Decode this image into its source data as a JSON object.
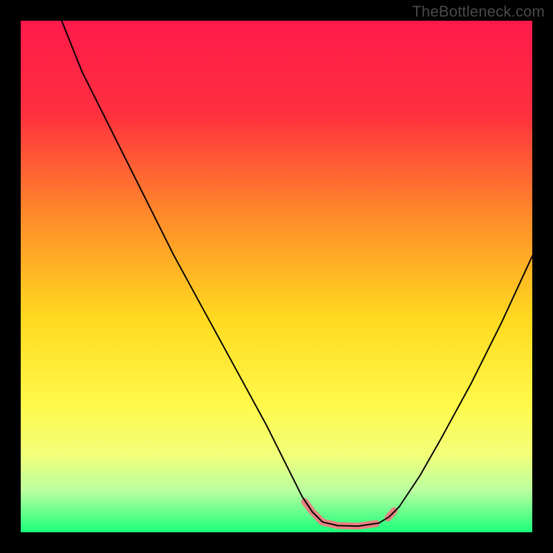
{
  "watermark": "TheBottleneck.com",
  "chart_data": {
    "type": "line",
    "title": "",
    "xlabel": "",
    "ylabel": "",
    "xlim": [
      0,
      100
    ],
    "ylim": [
      0,
      100
    ],
    "background_gradient": {
      "stops": [
        {
          "offset": 0.0,
          "color": "#ff1a4b"
        },
        {
          "offset": 0.18,
          "color": "#ff2f3f"
        },
        {
          "offset": 0.38,
          "color": "#ff8a2a"
        },
        {
          "offset": 0.58,
          "color": "#ffd91f"
        },
        {
          "offset": 0.75,
          "color": "#fff94a"
        },
        {
          "offset": 0.85,
          "color": "#f1ff7a"
        },
        {
          "offset": 0.92,
          "color": "#b8ffa0"
        },
        {
          "offset": 1.0,
          "color": "#1aff7a"
        }
      ]
    },
    "series": [
      {
        "name": "bottleneck-curve",
        "color": "#000000",
        "width": 2,
        "points": [
          {
            "x": 8.0,
            "y": 100.0
          },
          {
            "x": 12.0,
            "y": 90.0
          },
          {
            "x": 18.0,
            "y": 78.0
          },
          {
            "x": 24.0,
            "y": 66.0
          },
          {
            "x": 30.0,
            "y": 54.0
          },
          {
            "x": 36.0,
            "y": 43.0
          },
          {
            "x": 42.0,
            "y": 32.0
          },
          {
            "x": 48.0,
            "y": 21.0
          },
          {
            "x": 52.0,
            "y": 13.0
          },
          {
            "x": 55.0,
            "y": 7.0
          },
          {
            "x": 57.0,
            "y": 4.0
          },
          {
            "x": 59.0,
            "y": 2.0
          },
          {
            "x": 62.0,
            "y": 1.3
          },
          {
            "x": 66.0,
            "y": 1.2
          },
          {
            "x": 70.0,
            "y": 1.8
          },
          {
            "x": 72.0,
            "y": 3.0
          },
          {
            "x": 74.0,
            "y": 5.0
          },
          {
            "x": 78.0,
            "y": 11.0
          },
          {
            "x": 82.0,
            "y": 18.0
          },
          {
            "x": 88.0,
            "y": 29.0
          },
          {
            "x": 94.0,
            "y": 41.0
          },
          {
            "x": 100.0,
            "y": 54.0
          }
        ]
      }
    ],
    "highlight": {
      "color": "#e98080",
      "width": 10,
      "segments": [
        [
          {
            "x": 55.5,
            "y": 6.0
          },
          {
            "x": 57.0,
            "y": 4.0
          },
          {
            "x": 59.0,
            "y": 2.0
          },
          {
            "x": 62.0,
            "y": 1.3
          },
          {
            "x": 66.0,
            "y": 1.2
          },
          {
            "x": 69.5,
            "y": 1.7
          }
        ],
        [
          {
            "x": 71.8,
            "y": 2.8
          },
          {
            "x": 73.0,
            "y": 4.2
          }
        ]
      ]
    }
  }
}
